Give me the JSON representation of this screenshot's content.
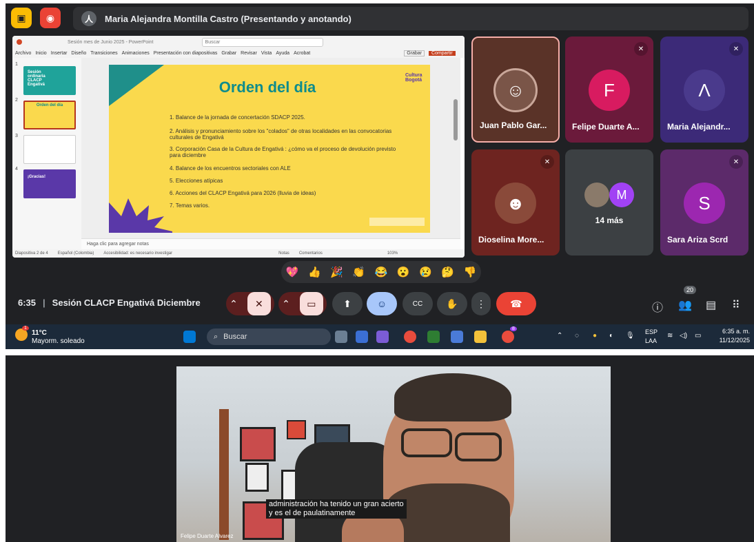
{
  "meeting": {
    "banner_text": "Maria Alejandra Montilla Castro (Presentando y anotando)",
    "time": "6:35",
    "separator": "|",
    "title": "Sesión CLACP Engativá Diciembre",
    "participants_count": "20",
    "reactions": [
      "💖",
      "👍",
      "🎉",
      "👏",
      "😂",
      "😮",
      "😢",
      "🤔",
      "👎"
    ]
  },
  "powerpoint": {
    "title_bar": "Sesión mes de Junio 2025 - PowerPoint",
    "search_placeholder": "Buscar",
    "menu": [
      "Archivo",
      "Inicio",
      "Insertar",
      "Diseño",
      "Transiciones",
      "Animaciones",
      "Presentación con diapositivas",
      "Grabar",
      "Revisar",
      "Vista",
      "Ayuda",
      "Acrobat"
    ],
    "record_label": "Grabar",
    "share_label": "Compartir",
    "thumbs": [
      {
        "num": "1",
        "text": "Sesión ordinaria CLACP Engativá"
      },
      {
        "num": "2",
        "text": "Orden del día"
      },
      {
        "num": "3",
        "text": ""
      },
      {
        "num": "4",
        "text": "¡Gracias!"
      }
    ],
    "slide": {
      "title": "Orden del día",
      "brand": "Cultura Bogotá",
      "items": [
        "1. Balance de la jornada de concertación  SDACP 2025.",
        "2. Análisis y pronunciamiento sobre los \"colados\" de otras localidades en las convocatorias culturales de Engativá",
        "3.  Corporación Casa de la Cultura de Engativá : ¿cómo va el proceso de devolución previsto para diciembre",
        "4. Balance de los encuentros sectoriales con ALE",
        "5. Elecciones atípicas",
        "6. Acciones del CLACP Engativá para 2026 (lluvia de ideas)",
        "7. Temas varios."
      ]
    },
    "notes": "Haga clic para agregar notas",
    "status": {
      "slide_of": "Diapositiva 2 de 4",
      "language": "Español (Colombia)",
      "accessibility": "Accesibilidad: es necesario investigar",
      "notes_btn": "Notas",
      "comments_btn": "Comentarios",
      "zoom": "103%"
    }
  },
  "tiles": [
    {
      "name": "Juan Pablo Gar...",
      "bg": "#5a3328",
      "muted": false
    },
    {
      "name": "Felipe Duarte A...",
      "bg": "#6b1a3b",
      "muted": true,
      "initial": "F",
      "avatar_bg": "#d81b60"
    },
    {
      "name": "Maria Alejandr...",
      "bg": "#3c2a78",
      "muted": true
    },
    {
      "name": "Dioselina More...",
      "bg": "#6e2420",
      "muted": true
    },
    {
      "name": "14 más",
      "bg": "#3c4043",
      "muted": false,
      "initial": "M"
    },
    {
      "name": "Sara Ariza Scrd",
      "bg": "#5c2a6a",
      "muted": true,
      "initial": "S",
      "avatar_bg": "#9c27b0"
    }
  ],
  "taskbar": {
    "weather_temp": "11°C",
    "weather_desc": "Mayorm. soleado",
    "weather_badge": "1",
    "search": "Buscar",
    "lang_top": "ESP",
    "lang_bottom": "LAA",
    "clock_time": "6:35 a. m.",
    "clock_date": "11/12/2025",
    "chrome_badge": "8"
  },
  "video": {
    "caption_line1": "administración ha tenido un gran acierto",
    "caption_line2": "y es el de paulatinamente",
    "speaker": "Felipe Duarte Alvarez"
  },
  "colors": {
    "hangup": "#ea4335",
    "accent_yellow": "#fad94d",
    "teal": "#0e8c8c"
  }
}
